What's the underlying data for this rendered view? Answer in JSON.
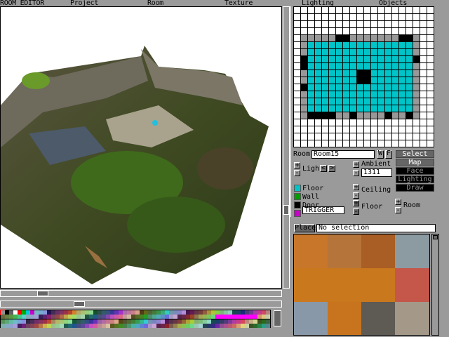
{
  "menu": [
    "ROOM EDITOR",
    "Project",
    "Room",
    "Texture",
    "Lighting",
    "Objects"
  ],
  "room": {
    "label": "Room:",
    "name": "Room15",
    "w_button": "W",
    "f_button": "F"
  },
  "modes": [
    {
      "label": "Select",
      "active": true
    },
    {
      "label": "Map",
      "active": true
    },
    {
      "label": "Face Edit",
      "active": false
    },
    {
      "label": "Lighting",
      "active": false
    },
    {
      "label": "Draw doors",
      "active": false
    }
  ],
  "light": {
    "label": "Light",
    "plus": "+",
    "minus": "-",
    "prev": "<",
    "next": ">"
  },
  "ambient": {
    "label": "Ambient",
    "value": "1311",
    "plus": "+",
    "minus": "-"
  },
  "ceiling": {
    "label": "Ceiling",
    "plus": "+",
    "minus": "-"
  },
  "floor": {
    "label": "Floor",
    "plus": "+",
    "minus": "-"
  },
  "room_height": {
    "label": "Room",
    "plus": "+",
    "minus": "-"
  },
  "legend": [
    {
      "label": "Floor",
      "color": "#00c4c8"
    },
    {
      "label": "Wall",
      "color": "#009e00"
    },
    {
      "label": "Door",
      "color": "#000000"
    },
    {
      "label": "TRIGGER",
      "color": "#c800c8"
    }
  ],
  "place": {
    "button": "Place",
    "status": "No selection"
  },
  "grid_map": {
    "legend": {
      "w": "#ffffff",
      "g": "#989898",
      "c": "#00c4c8",
      "k": "#000000"
    },
    "rows": [
      "wwwwwwwwwwwwwwwwwwww",
      "wwwwwwwwwwwwwwwwwwww",
      "wwwwwwwwwwwwwwwwwwww",
      "wwwwwwwwwwwwwwwwwwww",
      "wgggggkkgggggggkkgww",
      "wgcccccccccccccccgww",
      "wgcccccccccccccccgww",
      "wkccccccccccccccckww",
      "wkcccccccccccccccgww",
      "wgccccccckkccccccgww",
      "wgccccccckkccccccgww",
      "wkcccccccccccccccgww",
      "wgcccccccccccccccgww",
      "wgcccccccccccccccgww",
      "wgcccccccccccccccgww",
      "wgkkkkggkggggkggkgww",
      "wwwwwwwwwwwwwwwwwwww",
      "wwwwwwwwwwwwwwwwwwww",
      "wwwwwwwwwwwwwwwwwwww",
      "wwwwwwwwwwwwwwwwwwww"
    ]
  },
  "colors": {
    "bg": "#9a9a9a",
    "accent_cyan": "#00c4c8",
    "palette_selected": "#ff0000"
  }
}
